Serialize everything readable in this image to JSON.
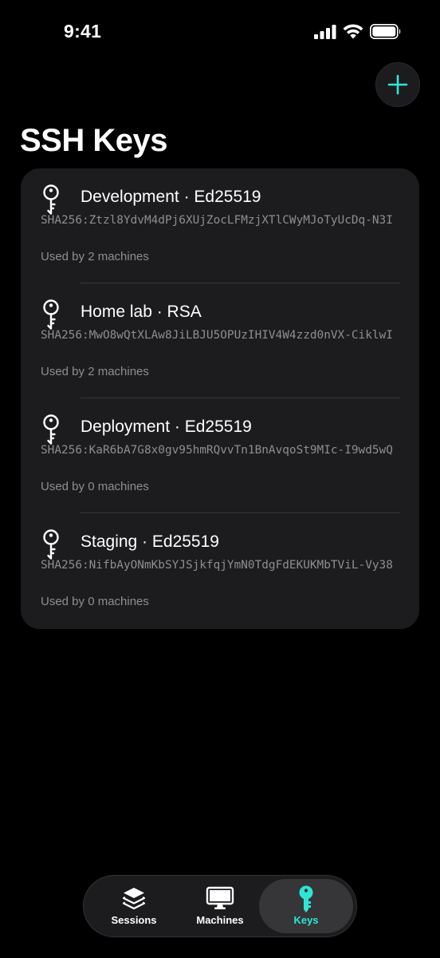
{
  "status_bar": {
    "time": "9:41"
  },
  "header": {
    "title": "SSH Keys"
  },
  "colors": {
    "accent": "#2ee6d6",
    "card": "#1c1c1e",
    "secondary_text": "#8e8e93"
  },
  "keys": [
    {
      "name": "Development · Ed25519",
      "fingerprint": "SHA256:Ztzl8YdvM4dPj6XUjZocLFMzjXTlCWyMJoTyUcDq-N3I",
      "usage": "Used by 2 machines"
    },
    {
      "name": "Home lab · RSA",
      "fingerprint": "SHA256:MwO8wQtXLAw8JiLBJU5OPUzIHIV4W4zzd0nVX-CiklwI",
      "usage": "Used by 2 machines"
    },
    {
      "name": "Deployment · Ed25519",
      "fingerprint": "SHA256:KaR6bA7G8x0gv95hmRQvvTn1BnAvqoSt9MIc-I9wd5wQ",
      "usage": "Used by 0 machines"
    },
    {
      "name": "Staging · Ed25519",
      "fingerprint": "SHA256:NifbAyONmKbSYJSjkfqjYmN0TdgFdEKUKMbTViL-Vy38",
      "usage": "Used by 0 machines"
    }
  ],
  "tab_bar": {
    "tabs": [
      {
        "label": "Sessions",
        "icon": "layers-icon"
      },
      {
        "label": "Machines",
        "icon": "desktop-icon"
      },
      {
        "label": "Keys",
        "icon": "key-icon",
        "selected": true
      }
    ]
  }
}
